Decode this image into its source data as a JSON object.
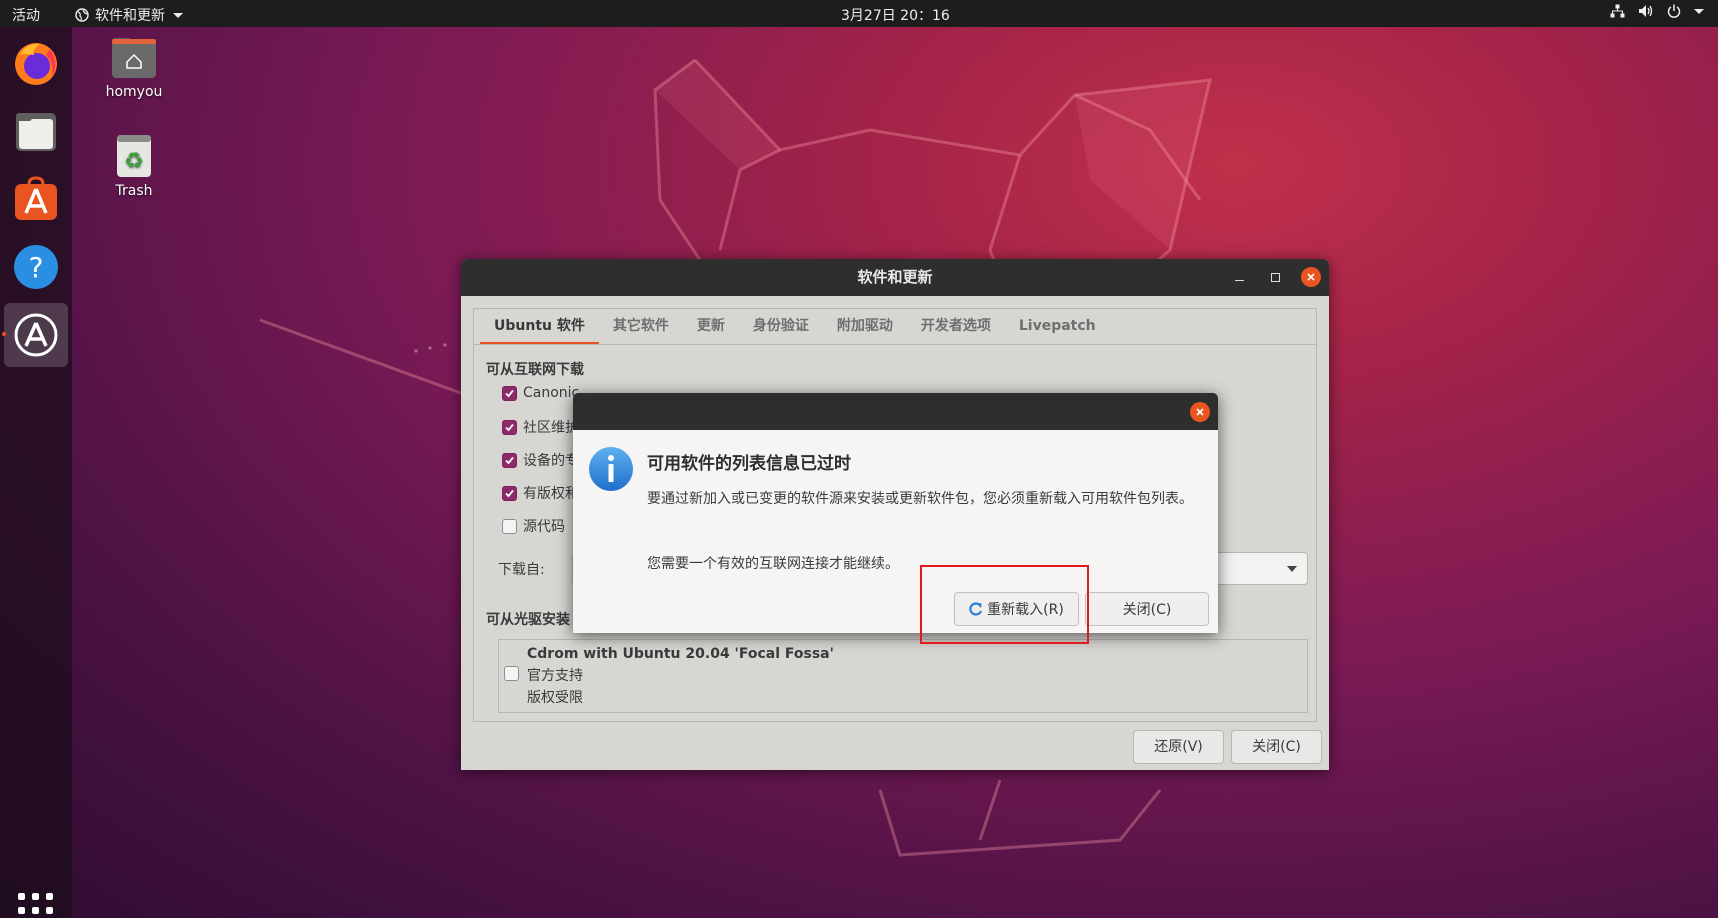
{
  "topbar": {
    "activities": "活动",
    "app_menu": "软件和更新",
    "clock": "3月27日  20：16"
  },
  "desktop": {
    "home_label": "homyou",
    "trash_label": "Trash"
  },
  "window": {
    "title": "软件和更新",
    "tabs": [
      "Ubuntu 软件",
      "其它软件",
      "更新",
      "身份验证",
      "附加驱动",
      "开发者选项",
      "Livepatch"
    ],
    "section_internet": "可从互联网下载",
    "checkboxes": [
      {
        "label": "Canonic",
        "checked": true
      },
      {
        "label": "社区维护",
        "checked": true
      },
      {
        "label": "设备的专",
        "checked": true
      },
      {
        "label": "有版权和",
        "checked": true
      },
      {
        "label": "源代码",
        "checked": false
      }
    ],
    "download_from": "下载自:",
    "section_cdrom": "可从光驱安装",
    "cdrom": {
      "title": "Cdrom with Ubuntu 20.04 'Focal Fossa'",
      "line1": "官方支持",
      "line2": "版权受限",
      "checked": false
    },
    "revert_button": "还原(V)",
    "close_button": "关闭(C)"
  },
  "dialog": {
    "heading": "可用软件的列表信息已过时",
    "body": "要通过新加入或已变更的软件源来安装或更新软件包，您必须重新载入可用软件包列表。",
    "note": "您需要一个有效的互联网连接才能继续。",
    "reload_button": "重新载入(R)",
    "close_button": "关闭(C)"
  },
  "colors": {
    "accent": "#e95420",
    "checkbox": "#8d2a6a",
    "highlight": "#e01b1b"
  }
}
